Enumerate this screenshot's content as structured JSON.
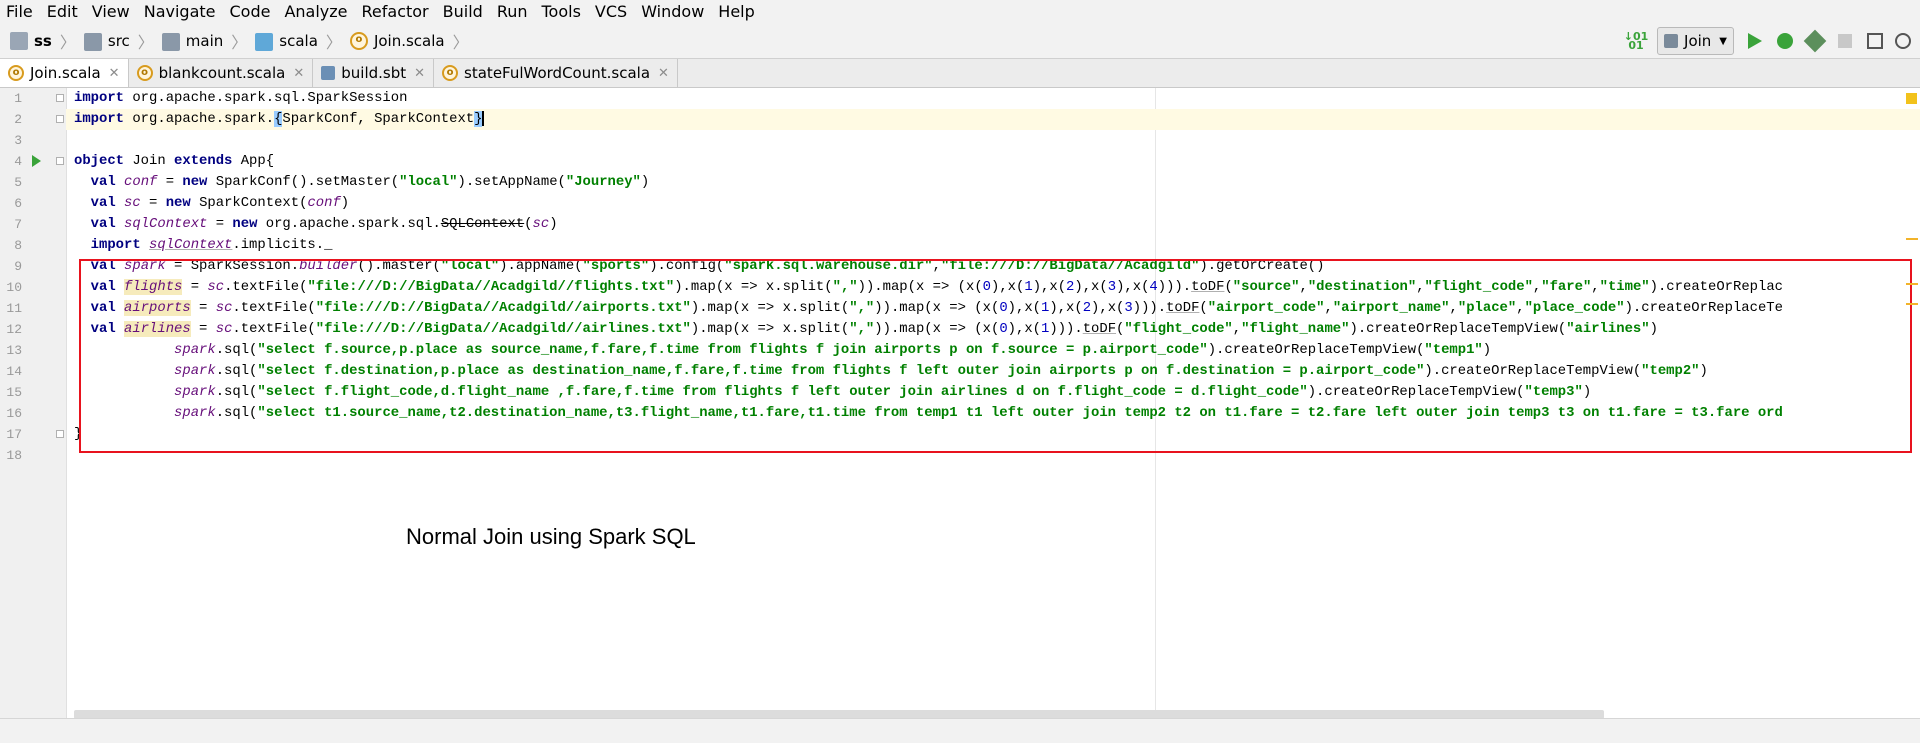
{
  "menu": [
    "File",
    "Edit",
    "View",
    "Navigate",
    "Code",
    "Analyze",
    "Refactor",
    "Build",
    "Run",
    "Tools",
    "VCS",
    "Window",
    "Help"
  ],
  "breadcrumb": [
    {
      "label": "ss",
      "icon": "project-icon"
    },
    {
      "label": "src",
      "icon": "folder-icon"
    },
    {
      "label": "main",
      "icon": "folder-icon"
    },
    {
      "label": "scala",
      "icon": "folder-icon"
    },
    {
      "label": "Join.scala",
      "icon": "scala-file-icon"
    }
  ],
  "run_config": {
    "label": "Join"
  },
  "tabs": [
    {
      "label": "Join.scala",
      "active": true,
      "icon": "scala-file-icon"
    },
    {
      "label": "blankcount.scala",
      "active": false,
      "icon": "scala-file-icon"
    },
    {
      "label": "build.sbt",
      "active": false,
      "icon": "sbt-file-icon"
    },
    {
      "label": "stateFulWordCount.scala",
      "active": false,
      "icon": "scala-file-icon"
    }
  ],
  "line_numbers": [
    "1",
    "2",
    "3",
    "4",
    "5",
    "6",
    "7",
    "8",
    "9",
    "10",
    "11",
    "12",
    "13",
    "14",
    "15",
    "16",
    "17",
    "18"
  ],
  "code_lines": [
    {
      "num": "1",
      "text": "import org.apache.spark.sql.SparkSession"
    },
    {
      "num": "2",
      "text": "import org.apache.spark.{SparkConf, SparkContext}"
    },
    {
      "num": "3",
      "text": ""
    },
    {
      "num": "4",
      "text": "object Join extends App{"
    },
    {
      "num": "5",
      "text": "  val conf = new SparkConf().setMaster(\"local\").setAppName(\"Journey\")"
    },
    {
      "num": "6",
      "text": "  val sc = new SparkContext(conf)"
    },
    {
      "num": "7",
      "text": "  val sqlContext = new org.apache.spark.sql.SQLContext(sc)"
    },
    {
      "num": "8",
      "text": "  import sqlContext.implicits._"
    },
    {
      "num": "9",
      "text": "  val spark = SparkSession.builder().master(\"local\").appName(\"sports\").config(\"spark.sql.warehouse.dir\",\"file:///D://BigData//Acadgild\").getOrCreate()"
    },
    {
      "num": "10",
      "text": "  val flights = sc.textFile(\"file:///D://BigData//Acadgild//flights.txt\").map(x => x.split(\",\")).map(x => (x(0),x(1),x(2),x(3),x(4))).toDF(\"source\",\"destination\",\"flight_code\",\"fare\",\"time\").createOrReplac"
    },
    {
      "num": "11",
      "text": "  val airports = sc.textFile(\"file:///D://BigData//Acadgild//airports.txt\").map(x => x.split(\",\")).map(x => (x(0),x(1),x(2),x(3))).toDF(\"airport_code\",\"airport_name\",\"place\",\"place_code\").createOrReplaceTe"
    },
    {
      "num": "12",
      "text": "  val airlines = sc.textFile(\"file:///D://BigData//Acadgild//airlines.txt\").map(x => x.split(\",\")).map(x => (x(0),x(1))).toDF(\"flight_code\",\"flight_name\").createOrReplaceTempView(\"airlines\")"
    },
    {
      "num": "13",
      "text": "            spark.sql(\"select f.source,p.place as source_name,f.fare,f.time from flights f join airports p on f.source = p.airport_code\").createOrReplaceTempView(\"temp1\")"
    },
    {
      "num": "14",
      "text": "            spark.sql(\"select f.destination,p.place as destination_name,f.fare,f.time from flights f left outer join airports p on f.destination = p.airport_code\").createOrReplaceTempView(\"temp2\")"
    },
    {
      "num": "15",
      "text": "            spark.sql(\"select f.flight_code,d.flight_name ,f.fare,f.time from flights f left outer join airlines d on f.flight_code = d.flight_code\").createOrReplaceTempView(\"temp3\")"
    },
    {
      "num": "16",
      "text": "            spark.sql(\"select t1.source_name,t2.destination_name,t3.flight_name,t1.fare,t1.time from temp1 t1 left outer join temp2 t2 on t1.fare = t2.fare left outer join temp3 t3 on t1.fare = t3.fare ord"
    },
    {
      "num": "17",
      "text": "}"
    },
    {
      "num": "18",
      "text": ""
    }
  ],
  "caption": "Normal Join using Spark SQL",
  "colors": {
    "keyword": "#000080",
    "string": "#008000",
    "variable": "#660e7a",
    "annotation_box": "#e8131e",
    "current_line": "#fffae3",
    "run_green": "#3aa33a"
  }
}
